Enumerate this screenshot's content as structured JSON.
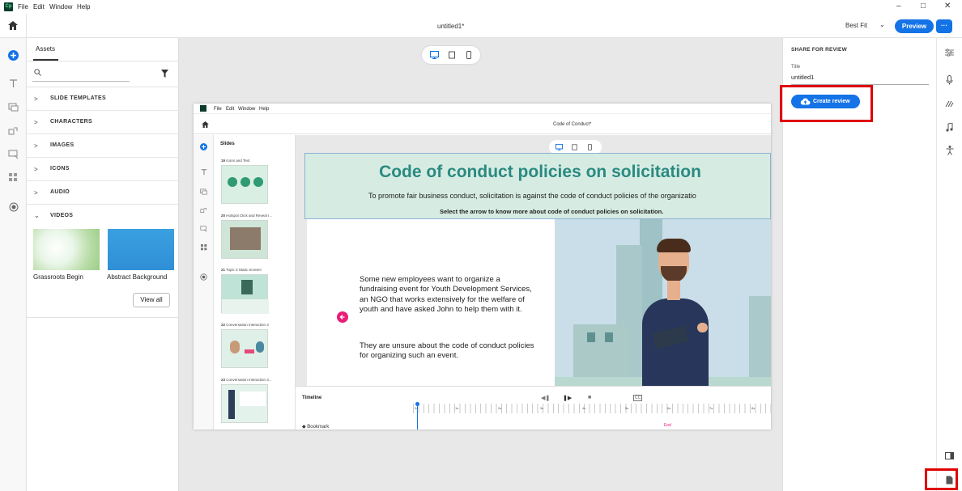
{
  "menu": {
    "app_icon": "Cp",
    "items": [
      "File",
      "Edit",
      "Window",
      "Help"
    ]
  },
  "window_controls": [
    "–",
    "□",
    "✕"
  ],
  "title": "untitled1*",
  "toolbar": {
    "zoom": "Best Fit",
    "preview_label": "Preview",
    "more_label": "···"
  },
  "left_tools": [
    "home-icon",
    "add-icon",
    "text-icon",
    "media-icon",
    "interactions-icon",
    "widgets-icon",
    "layout-icon",
    "record-icon"
  ],
  "assets": {
    "tab": "Assets",
    "search_placeholder": "",
    "categories": [
      "SLIDE TEMPLATES",
      "CHARACTERS",
      "IMAGES",
      "ICONS",
      "AUDIO",
      "VIDEOS"
    ],
    "videos": [
      {
        "name": "Grassroots Begin"
      },
      {
        "name": "Abstract Background"
      }
    ],
    "view_all": "View all"
  },
  "share": {
    "heading": "SHARE FOR REVIEW",
    "title_label": "Title",
    "title_value": "untitled1",
    "create_review": "Create review"
  },
  "inner": {
    "menu": [
      "File",
      "Edit",
      "Window",
      "Help"
    ],
    "title": "Code of Conduct*",
    "slides_label": "Slides",
    "slides": [
      {
        "num": "19",
        "name": "Icons and Text"
      },
      {
        "num": "20",
        "name": "Hotspot Click and Reveal I..."
      },
      {
        "num": "21",
        "name": "Topic 3 Static Screen!"
      },
      {
        "num": "22",
        "name": "Conversation Interaction 3"
      },
      {
        "num": "23",
        "name": "Conversation Interaction 3..."
      }
    ],
    "slide": {
      "heading": "Code of conduct policies on solicitation",
      "subheading": "To promote fair business conduct, solicitation is against the code of conduct policies of the organizatio",
      "instruction": "Select the arrow to know more about code of conduct policies on solicitation.",
      "para1": "Some new employees want to organize a fundraising event for Youth Development Services, an NGO that works extensively for the welfare of youth and have asked John to help them with it.",
      "para2": "They are unsure about the code of conduct policies for organizing such an event."
    },
    "timeline": {
      "label": "Timeline",
      "bookmark": "Bookmark",
      "end": "End",
      "ticks": [
        "0s",
        "1s",
        "2s",
        "3s",
        "4s",
        "5s",
        "6s",
        "7s",
        "8s"
      ]
    }
  },
  "colors": {
    "accent": "#1473e6",
    "teal_heading": "#2a8a80",
    "red_highlight": "#e00000",
    "pink": "#e91e78"
  }
}
